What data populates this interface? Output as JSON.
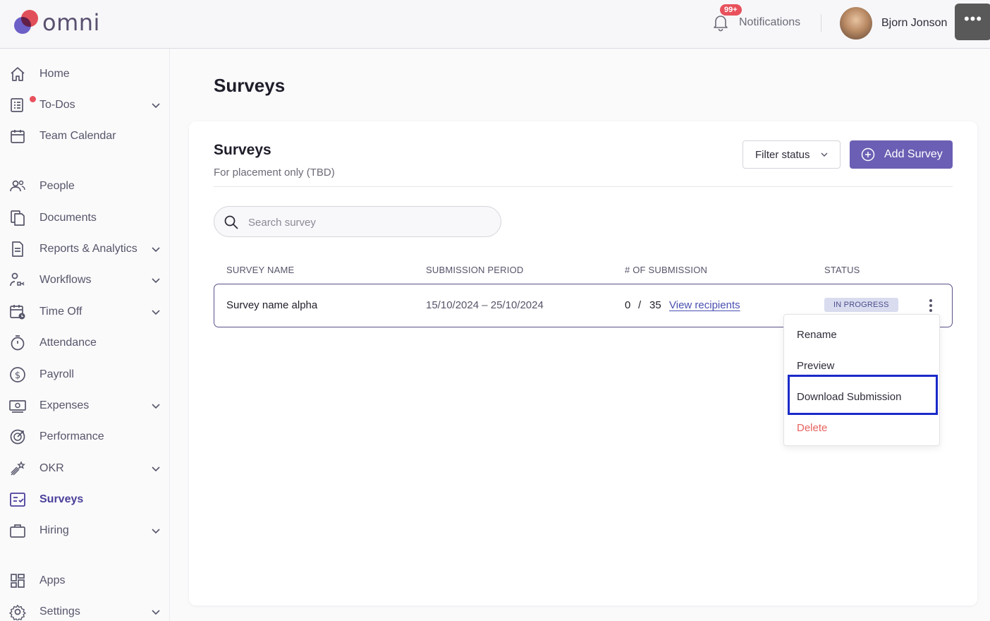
{
  "header": {
    "logo_text": "omni",
    "notifications_badge": "99+",
    "notifications_label": "Notifications",
    "user_name": "Bjorn Jonson",
    "more_label": "•••"
  },
  "sidebar": {
    "items": [
      {
        "label": "Home",
        "icon": "home-icon"
      },
      {
        "label": "To-Dos",
        "icon": "todo-icon"
      },
      {
        "label": "Team Calendar",
        "icon": "calendar-icon"
      },
      {
        "label": "People",
        "icon": "people-icon"
      },
      {
        "label": "Documents",
        "icon": "documents-icon"
      },
      {
        "label": "Reports & Analytics",
        "icon": "report-icon"
      },
      {
        "label": "Workflows",
        "icon": "workflow-icon"
      },
      {
        "label": "Time Off",
        "icon": "time-off-icon"
      },
      {
        "label": "Attendance",
        "icon": "stopwatch-icon"
      },
      {
        "label": "Payroll",
        "icon": "dollar-icon"
      },
      {
        "label": "Expenses",
        "icon": "money-icon"
      },
      {
        "label": "Performance",
        "icon": "performance-icon"
      },
      {
        "label": "OKR",
        "icon": "okr-icon"
      },
      {
        "label": "Surveys",
        "icon": "survey-icon"
      },
      {
        "label": "Hiring",
        "icon": "briefcase-icon"
      },
      {
        "label": "Apps",
        "icon": "apps-icon"
      },
      {
        "label": "Settings",
        "icon": "gear-icon"
      }
    ],
    "active": "Surveys"
  },
  "main": {
    "page_title": "Surveys",
    "card_title": "Surveys",
    "card_subtitle": "For placement only (TBD)",
    "filter_label": "Filter status",
    "add_label": "Add Survey",
    "search_placeholder": "Search survey",
    "columns": [
      "SURVEY NAME",
      "SUBMISSION PERIOD",
      "# OF SUBMISSION",
      "STATUS"
    ],
    "rows": [
      {
        "name": "Survey name alpha",
        "period": "15/10/2024 – 25/10/2024",
        "submitted": "0",
        "separator": "/",
        "total": "35",
        "recipients_link": "View recipients",
        "status": "IN PROGRESS"
      }
    ]
  },
  "menu": {
    "items": [
      "Rename",
      "Preview",
      "Download Submission",
      "Delete"
    ]
  },
  "colors": {
    "accent": "#6a5fb4",
    "active_nav": "#4a3f9a",
    "danger": "#e8625e",
    "highlight": "#1a2ac9",
    "badge": "#e8515c"
  }
}
